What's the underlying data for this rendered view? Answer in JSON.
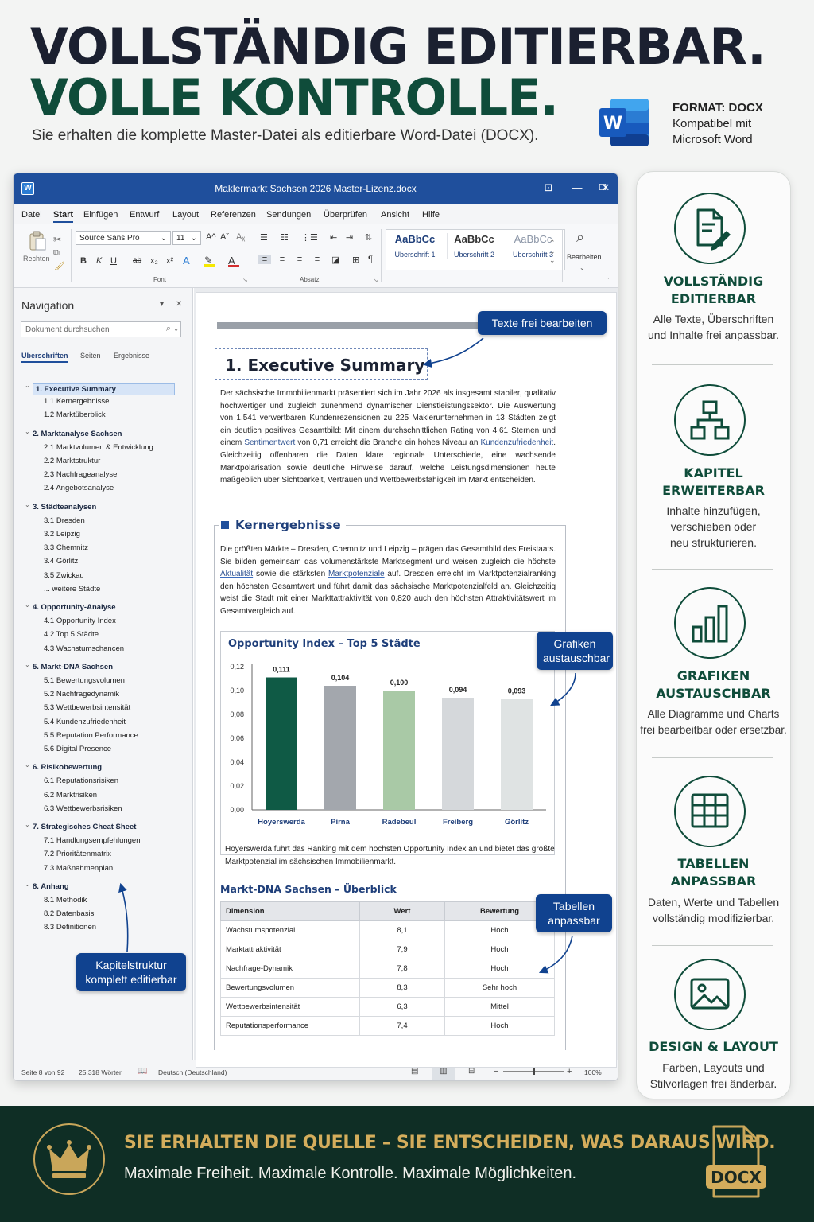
{
  "hero": {
    "line1": "VOLLSTÄNDIG EDITIERBAR.",
    "line2": "VOLLE KONTROLLE.",
    "subtitle": "Sie erhalten die komplette Master-Datei als editierbare Word-Datei (DOCX)."
  },
  "format": {
    "label": "FORMAT: DOCX",
    "compat_line1": "Kompatibel mit",
    "compat_line2": "Microsoft Word",
    "logo_letter": "W"
  },
  "window": {
    "app_glyph": "W",
    "title": "Maklermarkt Sachsen 2026 Master-Lizenz.docx",
    "controls": {
      "ribbon_toggle": "⊡",
      "minimize": "—",
      "maximize": "☐",
      "close": "✕"
    }
  },
  "menu": {
    "items": [
      "Datei",
      "Start",
      "Einfügen",
      "Entwurf",
      "Layout",
      "Referenzen",
      "Sendungen",
      "Überprüfen",
      "Ansicht",
      "Hilfe"
    ],
    "active": "Start"
  },
  "ribbon": {
    "paste_label": "Rechten",
    "font_name": "Source Sans Pro",
    "font_size": "11",
    "font_group": "Font",
    "paragraph_group": "Absatz",
    "styles": [
      {
        "sample": "AaBbCc",
        "name": "Überschrift 1"
      },
      {
        "sample": "AaBbCc",
        "name": "Überschrift 2"
      },
      {
        "sample": "AaBbCc",
        "name": "Überschrift 3"
      }
    ],
    "edit_label": "Bearbeiten",
    "format_buttons": [
      "B",
      "K",
      "U",
      "ab",
      "x₂",
      "x²",
      "A",
      "A"
    ],
    "grow_font": "A^",
    "shrink_font": "Aˇ",
    "clear_format": "Aᵪ",
    "para_icons": {
      "bullets": "☰",
      "numbering": "☷",
      "multilevel": "⋮☰",
      "outdent": "⇤",
      "indent": "⇥",
      "pilcrow": "¶",
      "sort": "⇅",
      "border": "⊞",
      "shading": "◪"
    },
    "align_icons": [
      "≡",
      "≡",
      "≡",
      "≡"
    ],
    "edit_icon": "⌕",
    "group_launcher": "↘",
    "collapse": "ˆ"
  },
  "nav": {
    "title": "Navigation",
    "search_placeholder": "Dokument durchsuchen",
    "search_icon": "⌕",
    "dropdown_icon": "▾",
    "close_icon": "✕",
    "tabs": [
      "Überschriften",
      "Seiten",
      "Ergebnisse"
    ],
    "items": [
      {
        "text": "1. Executive Summary",
        "level": 1,
        "selected": true
      },
      {
        "text": "1.1 Kernergebnisse",
        "level": 2
      },
      {
        "text": "1.2 Marktüberblick",
        "level": 2
      },
      {
        "text": "2. Marktanalyse Sachsen",
        "level": 1
      },
      {
        "text": "2.1 Marktvolumen & Entwicklung",
        "level": 2
      },
      {
        "text": "2.2 Marktstruktur",
        "level": 2
      },
      {
        "text": "2.3 Nachfrageanalyse",
        "level": 2
      },
      {
        "text": "2.4 Angebotsanalyse",
        "level": 2
      },
      {
        "text": "3. Städteanalysen",
        "level": 1
      },
      {
        "text": "3.1 Dresden",
        "level": 2
      },
      {
        "text": "3.2 Leipzig",
        "level": 2
      },
      {
        "text": "3.3 Chemnitz",
        "level": 2
      },
      {
        "text": "3.4 Görlitz",
        "level": 2
      },
      {
        "text": "3.5 Zwickau",
        "level": 2
      },
      {
        "text": "... weitere Städte",
        "level": 2
      },
      {
        "text": "4. Opportunity-Analyse",
        "level": 1
      },
      {
        "text": "4.1 Opportunity Index",
        "level": 2
      },
      {
        "text": "4.2 Top 5 Städte",
        "level": 2
      },
      {
        "text": "4.3 Wachstumschancen",
        "level": 2
      },
      {
        "text": "5. Markt-DNA Sachsen",
        "level": 1
      },
      {
        "text": "5.1 Bewertungsvolumen",
        "level": 2
      },
      {
        "text": "5.2 Nachfragedynamik",
        "level": 2
      },
      {
        "text": "5.3 Wettbewerbsintensität",
        "level": 2
      },
      {
        "text": "5.4 Kundenzufriedenheit",
        "level": 2
      },
      {
        "text": "5.5 Reputation Performance",
        "level": 2
      },
      {
        "text": "5.6 Digital Presence",
        "level": 2
      },
      {
        "text": "6. Risikobewertung",
        "level": 1
      },
      {
        "text": "6.1 Reputationsrisiken",
        "level": 2
      },
      {
        "text": "6.2 Marktrisiken",
        "level": 2
      },
      {
        "text": "6.3 Wettbewerbsrisiken",
        "level": 2
      },
      {
        "text": "7. Strategisches Cheat Sheet",
        "level": 1
      },
      {
        "text": "7.1 Handlungsempfehlungen",
        "level": 2
      },
      {
        "text": "7.2 Prioritätenmatrix",
        "level": 2
      },
      {
        "text": "7.3 Maßnahmenplan",
        "level": 2
      },
      {
        "text": "8. Anhang",
        "level": 1
      },
      {
        "text": "8.1 Methodik",
        "level": 2
      },
      {
        "text": "8.2 Datenbasis",
        "level": 2
      },
      {
        "text": "8.3 Definitionen",
        "level": 2
      }
    ]
  },
  "doc": {
    "heading": "1. Executive Summary",
    "summary_a": "Der sächsische Immobilienmarkt präsentiert sich im Jahr 2026 als insgesamt stabiler, qualitativ hochwertiger und zugleich zunehmend dynamischer Dienstleistungssektor. Die Auswertung von 1.541 verwertbaren Kundenrezensionen zu 225 Maklerunternehmen in 13 Städten zeigt ein deutlich positives Gesamtbild: Mit einem durchschnittlichen Rating von 4,61 Sternen und einem ",
    "summary_link1": "Sentimentwert",
    "summary_b": " von 0,71 erreicht die Branche ein hohes Niveau an ",
    "summary_link2": "Kundenzufriedenheit",
    "summary_c": ". Gleichzeitig offenbaren die Daten klare regionale Unterschiede, eine wachsende Marktpolarisation sowie deutliche Hinweise darauf, welche Leistungsdimensionen heute maßgeblich über Sichtbarkeit, Vertrauen und Wettbewerbsfähigkeit im Markt entscheiden.",
    "kern_title": "Kernergebnisse",
    "kern_a": "Die größten Märkte – Dresden, Chemnitz und Leipzig – prägen das Gesamtbild des Freistaats. Sie bilden gemeinsam das volumenstärkste Marktsegment und weisen zugleich die höchste ",
    "kern_link1": "Aktualität",
    "kern_b": " sowie die stärksten ",
    "kern_link2": "Marktpotenziale",
    "kern_c": " auf. Dresden erreicht im Marktpotenzialranking den höchsten Gesamtwert und führt damit das sächsische Marktpotenzialfeld an. Gleichzeitig weist die Stadt mit einer Markttattraktivität von 0,820 auch den höchsten Attraktivitätswert im Gesamtvergleich auf.",
    "chart_caption": "Hoyerswerda führt das Ranking mit dem höchsten Opportunity Index an und bietet das größte Marktpotenzial im sächsischen Immobilienmarkt.",
    "table_title": "Markt-DNA Sachsen – Überblick",
    "table_headers": [
      "Dimension",
      "Wert",
      "Bewertung"
    ],
    "table_rows": [
      [
        "Wachstumspotenzial",
        "8,1",
        "Hoch"
      ],
      [
        "Marktattraktivität",
        "7,9",
        "Hoch"
      ],
      [
        "Nachfrage-Dynamik",
        "7,8",
        "Hoch"
      ],
      [
        "Bewertungsvolumen",
        "8,3",
        "Sehr hoch"
      ],
      [
        "Wettbewerbsintensität",
        "6,3",
        "Mittel"
      ],
      [
        "Reputationsperformance",
        "7,4",
        "Hoch"
      ]
    ]
  },
  "chart_data": {
    "type": "bar",
    "title": "Opportunity Index – Top 5 Städte",
    "categories": [
      "Hoyerswerda",
      "Pirna",
      "Radebeul",
      "Freiberg",
      "Görlitz"
    ],
    "values": [
      0.111,
      0.104,
      0.1,
      0.094,
      0.093
    ],
    "value_labels": [
      "0,111",
      "0,104",
      "0,100",
      "0,094",
      "0,093"
    ],
    "bar_colors": [
      "#0f5a45",
      "#a3a7ad",
      "#a9c9a6",
      "#d5d8db",
      "#dfe3e3"
    ],
    "ylim": [
      0,
      0.12
    ],
    "yticks": [
      "0,00",
      "0,02",
      "0,04",
      "0,06",
      "0,08",
      "0,10",
      "0,12"
    ],
    "xlabel": "",
    "ylabel": "",
    "grid": false
  },
  "status": {
    "page": "Seite 8 von 92",
    "words": "25.318 Wörter",
    "language": "Deutsch (Deutschland)",
    "zoom": "100%",
    "zoom_level": 1.0,
    "zoom_minus": "−",
    "zoom_plus": "+"
  },
  "callouts": {
    "texte": "Texte frei bearbeiten",
    "grafiken": [
      "Grafiken",
      "austauschbar"
    ],
    "tabellen": [
      "Tabellen",
      "anpassbar"
    ],
    "kapitel": [
      "Kapitelstruktur",
      "komplett editierbar"
    ]
  },
  "features": [
    {
      "icon": "document-edit-icon",
      "title": [
        "VOLLSTÄNDIG",
        "EDITIERBAR"
      ],
      "desc": [
        "Alle Texte, Überschriften",
        "und Inhalte frei anpassbar."
      ]
    },
    {
      "icon": "hierarchy-icon",
      "title": [
        "KAPITEL",
        "ERWEITERBAR"
      ],
      "desc": [
        "Inhalte hinzufügen,",
        "verschieben oder",
        "neu strukturieren."
      ]
    },
    {
      "icon": "bar-chart-icon",
      "title": [
        "GRAFIKEN",
        "AUSTAUSCHBAR"
      ],
      "desc": [
        "Alle Diagramme und Charts",
        "frei bearbeitbar oder ersetzbar."
      ]
    },
    {
      "icon": "table-icon",
      "title": [
        "TABELLEN",
        "ANPASSBAR"
      ],
      "desc": [
        "Daten, Werte und Tabellen",
        "vollständig modifizierbar."
      ]
    },
    {
      "icon": "image-icon",
      "title": [
        "DESIGN & LAYOUT"
      ],
      "desc": [
        "Farben, Layouts und",
        "Stilvorlagen frei änderbar."
      ]
    }
  ],
  "footer": {
    "line1": "SIE ERHALTEN DIE QUELLE – SIE ENTSCHEIDEN, WAS DARAUS WIRD.",
    "line2": "Maximale Freiheit. Maximale Kontrolle. Maximale Möglichkeiten.",
    "badge": "DOCX"
  },
  "colors": {
    "brand_green": "#0f4c3a",
    "word_blue": "#1f4f9c",
    "gold": "#d4ad5c",
    "footer_bg": "#0f2e25"
  }
}
